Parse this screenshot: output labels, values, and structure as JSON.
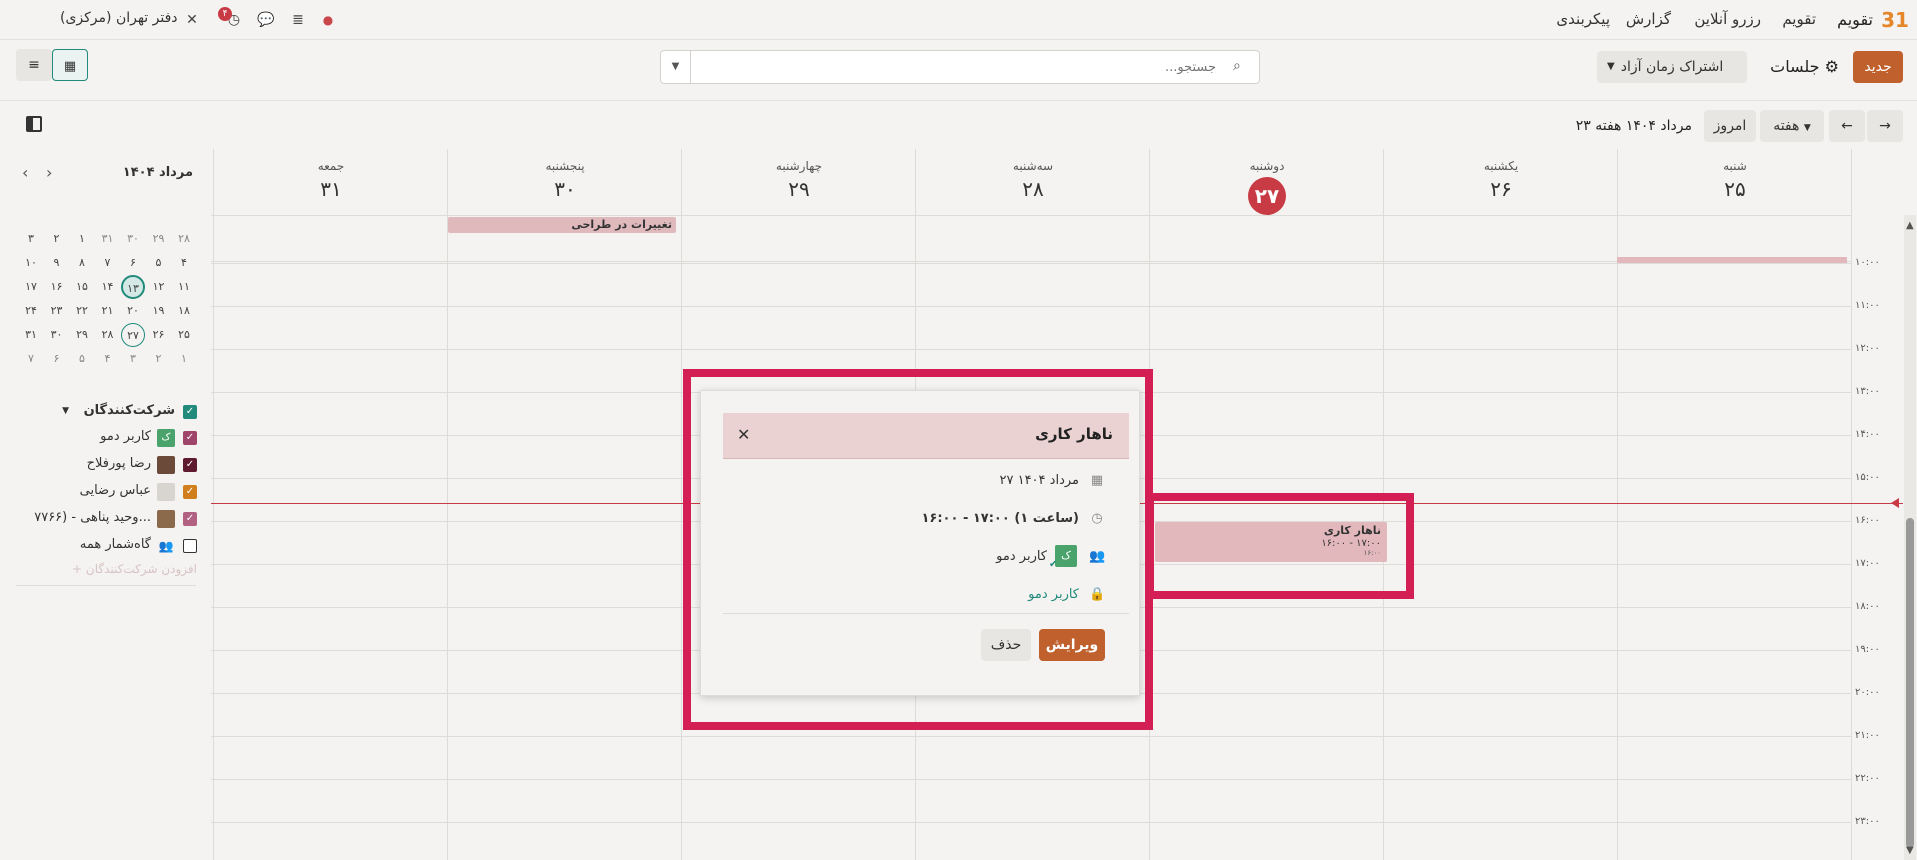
{
  "navbar": {
    "logo": "31",
    "app_name": "تقویم",
    "menu": [
      "تقویم",
      "رزرو آنلاین",
      "گزارش",
      "پیکربندی"
    ],
    "company": "دفتر تهران (مرکزی)",
    "activity_badge": "۴"
  },
  "control": {
    "new_label": "جدید",
    "breadcrumb": "جلسات",
    "share_label": "اشتراک زمان آزاد",
    "search_placeholder": "جستجو..."
  },
  "toolbar2": {
    "today_label": "امروز",
    "scale_label": "هفته",
    "period_label": "مرداد ۱۴۰۴ هفته ۲۳"
  },
  "calendar": {
    "days": [
      {
        "name": "شنبه",
        "num": "۲۵"
      },
      {
        "name": "یکشنبه",
        "num": "۲۶"
      },
      {
        "name": "دوشنبه",
        "num": "۲۷",
        "today": true
      },
      {
        "name": "سه‌شنبه",
        "num": "۲۸"
      },
      {
        "name": "چهارشنبه",
        "num": "۲۹"
      },
      {
        "name": "پنجشنبه",
        "num": "۳۰"
      },
      {
        "name": "جمعه",
        "num": "۳۱"
      }
    ],
    "times": [
      "۱۰:۰۰",
      "۱۱:۰۰",
      "۱۲:۰۰",
      "۱۳:۰۰",
      "۱۴:۰۰",
      "۱۵:۰۰",
      "۱۶:۰۰",
      "۱۷:۰۰",
      "۱۸:۰۰",
      "۱۹:۰۰",
      "۲۰:۰۰",
      "۲۱:۰۰",
      "۲۲:۰۰",
      "۲۳:۰۰"
    ],
    "allday_event": "تغییرات در طراحی",
    "event": {
      "title": "ناهار کاری",
      "time": "۱۶:۰۰ - ۱۷:۰۰",
      "extra": "۱۶:۰۰"
    }
  },
  "sidebar": {
    "month_label": "مرداد ۱۴۰۴",
    "weeks": [
      [
        "۲۸",
        "۲۹",
        "۳۰",
        "۳۱",
        "۱",
        "۲",
        "۳"
      ],
      [
        "۴",
        "۵",
        "۶",
        "۷",
        "۸",
        "۹",
        "۱۰"
      ],
      [
        "۱۱",
        "۱۲",
        "۱۳",
        "۱۴",
        "۱۵",
        "۱۶",
        "۱۷"
      ],
      [
        "۱۸",
        "۱۹",
        "۲۰",
        "۲۱",
        "۲۲",
        "۲۳",
        "۲۴"
      ],
      [
        "۲۵",
        "۲۶",
        "۲۷",
        "۲۸",
        "۲۹",
        "۳۰",
        "۳۱"
      ],
      [
        "۱",
        "۲",
        "۳",
        "۴",
        "۵",
        "۶",
        "۷"
      ]
    ],
    "attendees_header": "شرکت‌کنندگان",
    "attendees": [
      {
        "name": "کاربر دمو",
        "color": "#a0456a",
        "avatar": "ک",
        "avatar_color": "#4aa36b"
      },
      {
        "name": "رضا پورفلاح",
        "color": "#5e1a2f",
        "avatar": "",
        "avatar_color": "#6b4a3a"
      },
      {
        "name": "عباس رضایی",
        "color": "#d07f1c",
        "avatar": "",
        "avatar_color": "#d8d4cf"
      },
      {
        "name": "وحید پناهی - (۷۷۶۶...",
        "color": "#b26182",
        "avatar": "",
        "avatar_color": "#8a6a4a"
      },
      {
        "name": "گاه‌شمار همه",
        "color": "",
        "avatar": "",
        "avatar_color": ""
      }
    ],
    "add_attendee": "+ افزودن شرکت‌کنندگان"
  },
  "popover": {
    "title": "ناهار کاری",
    "date": "۲۷ مرداد ۱۴۰۴",
    "time": "۱۶:۰۰ - ۱۷:۰۰ (۱ ساعت)",
    "attendee": "کاربر دمو",
    "attendee_avatar": "ک",
    "organizer": "کاربر دمو",
    "edit_label": "ویرایش",
    "delete_label": "حذف"
  }
}
